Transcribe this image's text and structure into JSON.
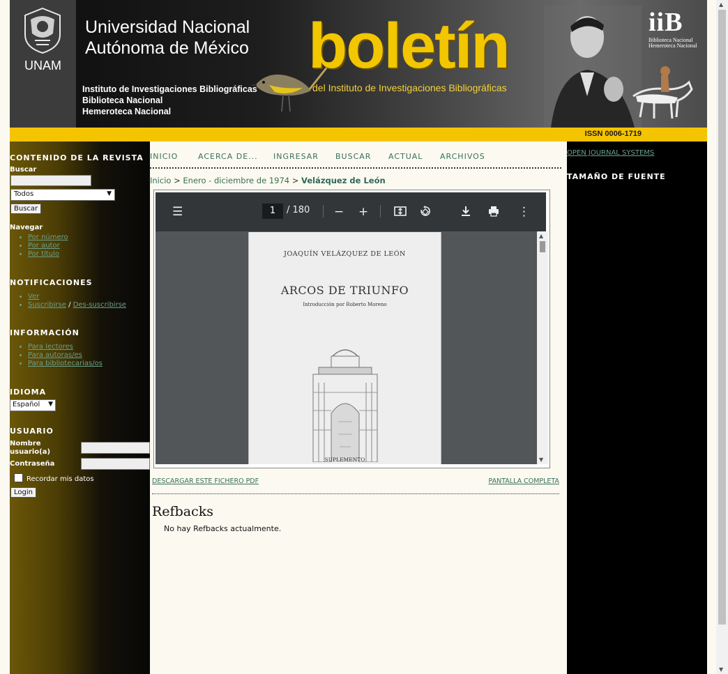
{
  "header": {
    "unam_label": "UNAM",
    "university_line1": "Universidad Nacional",
    "university_line2": "Autónoma de México",
    "inst_line1": "Instituto de Investigaciones Bibliográficas",
    "inst_line2": "Biblioteca Nacional",
    "inst_line3": "Hemeroteca Nacional",
    "title": "boletín",
    "subtitle": "del Instituto de Investigaciones Bibliográficas",
    "logo_mark": "iiB",
    "logo_line1": "Biblioteca Nacional",
    "logo_line2": "Hemeroteca Nacional",
    "issn": "ISSN 0006-1719",
    "colors": {
      "yellow": "#f5c400",
      "title_yellow": "#f2c600"
    }
  },
  "sidebar": {
    "journal_content_title": "CONTENIDO DE LA REVISTA",
    "search_label": "Buscar",
    "search_scope": "Todos",
    "search_button": "Buscar",
    "browse_label": "Navegar",
    "browse_items": [
      "Por número",
      "Por autor",
      "Por título"
    ],
    "notifications_title": "NOTIFICACIONES",
    "notify_view": "Ver",
    "notify_subscribe": "Suscribirse",
    "notify_sep": "/",
    "notify_unsubscribe": "Des-suscribirse",
    "info_title": "INFORMACIÓN",
    "info_items": [
      "Para lectores",
      "Para autoras/es",
      "Para bibliotecarias/os"
    ],
    "language_title": "IDIOMA",
    "language_value": "Español",
    "user_title": "USUARIO",
    "username_label": "Nombre usuario(a)",
    "password_label": "Contraseña",
    "remember_label": "Recordar mis datos",
    "login_button": "Login"
  },
  "nav": {
    "items": [
      "INICIO",
      "ACERCA DE...",
      "INGRESAR",
      "BUSCAR",
      "ACTUAL",
      "ARCHIVOS"
    ]
  },
  "breadcrumb": {
    "home": "Inicio",
    "sep": ">",
    "issue": "Enero - diciembre de 1974",
    "current": "Velázquez de León"
  },
  "pdf": {
    "page_current": "1",
    "page_total": "/ 180",
    "page_author": "JOAQUÍN VELÁZQUEZ DE LEÓN",
    "page_title": "ARCOS DE TRIUNFO",
    "page_intro": "Introducción por Roberto Moreno",
    "page_footer": "SUPLEMENTO"
  },
  "links": {
    "download": "DESCARGAR ESTE FICHERO PDF",
    "fullscreen": "PANTALLA COMPLETA"
  },
  "refbacks": {
    "title": "Refbacks",
    "empty_text": "No hay Refbacks actualmente."
  },
  "right_sidebar": {
    "ojs_link": "OPEN JOURNAL SYSTEMS",
    "font_size_title": "TAMAÑO DE FUENTE"
  }
}
